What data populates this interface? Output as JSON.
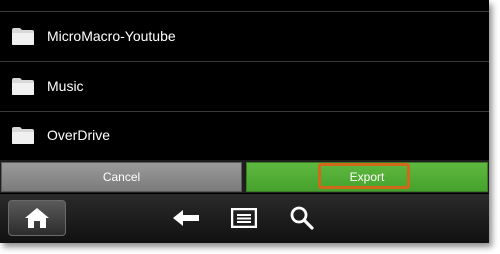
{
  "folders": [
    {
      "label": "MicroMacro-Youtube",
      "icon": "folder-icon"
    },
    {
      "label": "Music",
      "icon": "folder-icon"
    },
    {
      "label": "OverDrive",
      "icon": "folder-icon"
    }
  ],
  "buttons": {
    "cancel_label": "Cancel",
    "export_label": "Export"
  },
  "navbar": {
    "icons": [
      "home-icon",
      "back-arrow-icon",
      "menu-icon",
      "search-icon"
    ]
  },
  "colors": {
    "export_green": "#4caf34",
    "highlight_orange": "#d06a1a",
    "cancel_gray": "#888888"
  }
}
